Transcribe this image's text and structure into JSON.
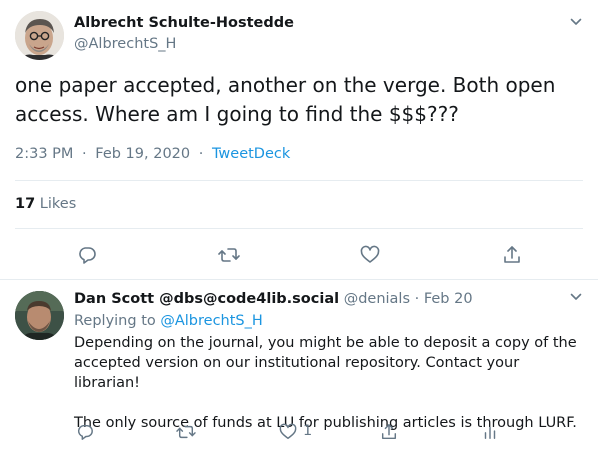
{
  "main_tweet": {
    "author_name": "Albrecht Schulte-Hostedde",
    "author_handle": "@AlbrechtS_H",
    "text": "one paper accepted, another on the verge. Both open access. Where am I going to find the $$$???",
    "time": "2:33 PM",
    "separator": "·",
    "date": "Feb 19, 2020",
    "source": "TweetDeck",
    "likes_count": "17",
    "likes_label": "Likes"
  },
  "reply": {
    "author_name": "Dan Scott @dbs@code4lib.social",
    "author_handle": "@denials",
    "separator": "·",
    "date": "Feb 20",
    "replying_to_label": "Replying to",
    "replying_to_handle": "@AlbrechtS_H",
    "paragraph_1": "Depending on the journal, you might be able to deposit a copy of the accepted version on our institutional repository. Contact your librarian!",
    "paragraph_2": "The only source of funds at LU for publishing articles is through LURF.",
    "like_count": "1"
  },
  "colors": {
    "text": "#14171a",
    "secondary": "#657786",
    "link": "#1b95e0",
    "divider": "#e6ecf0"
  },
  "icons": {
    "caret": "chevron-down-icon",
    "reply": "reply-icon",
    "retweet": "retweet-icon",
    "like": "heart-icon",
    "share": "share-icon",
    "analytics": "analytics-icon"
  }
}
